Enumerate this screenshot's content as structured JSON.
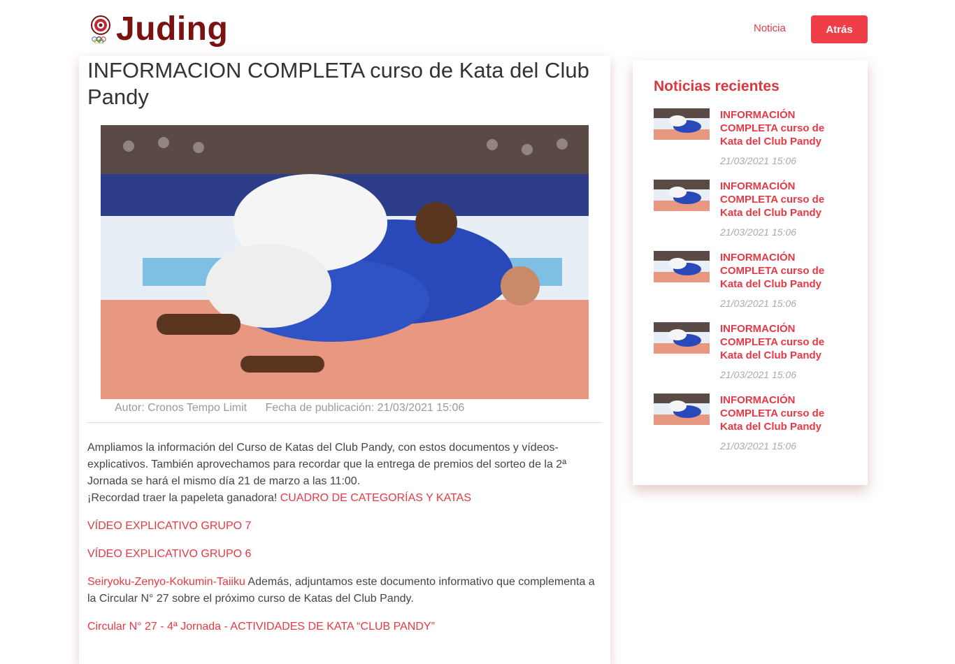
{
  "header": {
    "logo_text": "Juding",
    "nav_link": "Noticia",
    "back_button": "Atrás"
  },
  "article": {
    "title": "INFORMACION COMPLETA curso de Kata del Club Pandy",
    "author": "Autor: Cronos Tempo Limit",
    "published": "Fecha de publicación: 21/03/2021 15:06",
    "paragraph1": "Ampliamos la información del Curso de Katas del Club Pandy, con estos documentos y vídeos-explicativos. También aprovechamos para recordar que la entrega de premios del sorteo de la 2ª Jornada se hará el mismo día 21 de marzo a las 11:00.",
    "paragraph1_line2": "¡Recordad traer la papeleta ganadora!",
    "link_categories": "CUADRO DE CATEGORÍAS Y KATAS",
    "link_video7": "VÍDEO EXPLICATIVO GRUPO 7",
    "link_video6": "VÍDEO EXPLICATIVO GRUPO 6",
    "link_seiryoku": "Seiryoku-Zenyo-Kokumin-Taiiku",
    "paragraph_seiryoku": " Además, adjuntamos este documento informativo que complementa a la Circular N° 27 sobre el próximo curso de Katas del Club Pandy.",
    "link_circular": "Circular N° 27 - 4ª Jornada - ACTIVIDADES DE KATA “CLUB PANDY”"
  },
  "sidebar": {
    "title": "Noticias recientes",
    "items": [
      {
        "title": "INFORMACIÓN COMPLETA curso de Kata del Club Pandy",
        "date": "21/03/2021 15:06"
      },
      {
        "title": "INFORMACIÓN COMPLETA curso de Kata del Club Pandy",
        "date": "21/03/2021 15:06"
      },
      {
        "title": "INFORMACIÓN COMPLETA curso de Kata del Club Pandy",
        "date": "21/03/2021 15:06"
      },
      {
        "title": "INFORMACIÓN COMPLETA curso de Kata del Club Pandy",
        "date": "21/03/2021 15:06"
      },
      {
        "title": "INFORMACIÓN COMPLETA curso de Kata del Club Pandy",
        "date": "21/03/2021 15:06"
      }
    ]
  },
  "colors": {
    "accent": "#e63946",
    "brand": "#7a1212",
    "button": "#ef3e48"
  }
}
